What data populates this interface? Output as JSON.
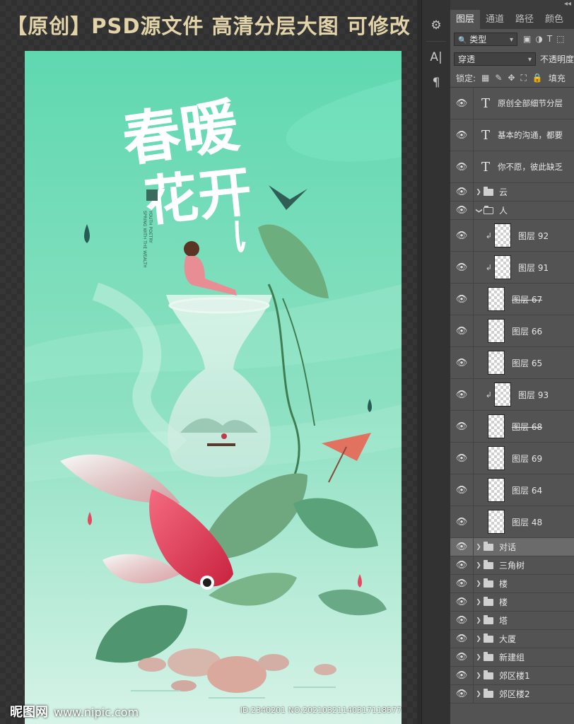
{
  "headline": "【原创】PSD源文件   高清分层大图 可修改",
  "poster": {
    "title_top": "春暖",
    "title_bottom": "花开",
    "vertical_text_1": "YOUTH POETRY",
    "vertical_text_2": "SPRING WITH THE WEALTH",
    "colors": {
      "bg_top": "#5fd8b0",
      "bg_bottom": "#c9eedf",
      "fish": "#e63a55",
      "leaf": "#5aa37a"
    }
  },
  "watermark": {
    "logo_text": "昵图网",
    "url": "www.nipic.com",
    "id_text": "ID:2340201 NO:20210321140317118577"
  },
  "toolstrip": {
    "tools": [
      "settings-sliders-icon",
      "type-tool-icon",
      "paragraph-icon"
    ],
    "glyphs": [
      "⚙",
      "A|",
      "¶"
    ]
  },
  "panel": {
    "collapse_glyph": "◂◂",
    "tabs": [
      {
        "label": "图层",
        "active": true
      },
      {
        "label": "通道",
        "active": false
      },
      {
        "label": "路径",
        "active": false
      },
      {
        "label": "颜色",
        "active": false
      }
    ],
    "filter_search_glyph": "🔍",
    "filter_value": "类型",
    "filter_icons": [
      "▣",
      "◑",
      "T",
      "⬚"
    ],
    "blend_mode": "穿透",
    "opacity_label": "不透明度",
    "lock_label": "锁定:",
    "lock_icons": [
      "▦",
      "✎",
      "✥",
      "⛶",
      "🔒"
    ],
    "fill_label": "填充",
    "eye_glyph": "👁",
    "text_glyph": "T",
    "clip_glyph": "↲",
    "arrow_closed": "❯",
    "arrow_open": "❯",
    "layers": [
      {
        "type": "text",
        "name": "原创全部细节分层"
      },
      {
        "type": "text",
        "name": "基本的沟通，都要"
      },
      {
        "type": "text",
        "name": "你不愿，彼此缺乏"
      },
      {
        "type": "group",
        "name": "云"
      },
      {
        "type": "group-open",
        "name": "人"
      },
      {
        "type": "pixel",
        "name": "图层 92",
        "clip": true
      },
      {
        "type": "pixel",
        "name": "图层 91",
        "clip": true
      },
      {
        "type": "pixel",
        "name": "图层 67",
        "strike": true
      },
      {
        "type": "pixel",
        "name": "图层 66"
      },
      {
        "type": "pixel",
        "name": "图层 65"
      },
      {
        "type": "pixel",
        "name": "图层 93",
        "clip": true
      },
      {
        "type": "pixel",
        "name": "图层 68",
        "strike": true
      },
      {
        "type": "pixel",
        "name": "图层 69"
      },
      {
        "type": "pixel",
        "name": "图层 64"
      },
      {
        "type": "pixel",
        "name": "图层 48"
      },
      {
        "type": "group",
        "name": "对话",
        "highlight": true
      },
      {
        "type": "group",
        "name": "三角树"
      },
      {
        "type": "group",
        "name": "楼"
      },
      {
        "type": "group",
        "name": "楼"
      },
      {
        "type": "group",
        "name": "塔"
      },
      {
        "type": "group",
        "name": "大厦"
      },
      {
        "type": "group",
        "name": "新建组"
      },
      {
        "type": "group",
        "name": "郊区楼1"
      },
      {
        "type": "group",
        "name": "郊区楼2"
      }
    ]
  }
}
